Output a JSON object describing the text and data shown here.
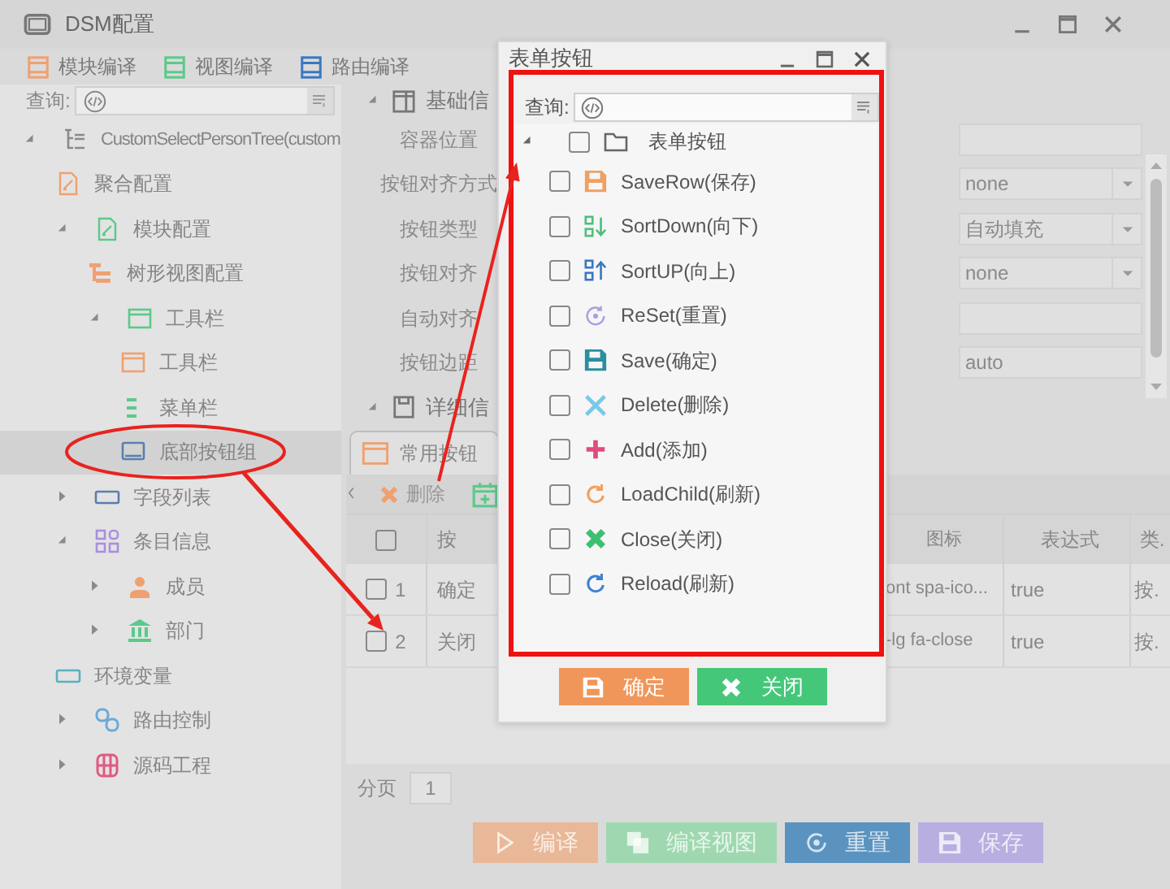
{
  "window": {
    "title": "DSM配置"
  },
  "toolbar": [
    {
      "label": "模块编译",
      "color": "#f0a070"
    },
    {
      "label": "视图编译",
      "color": "#5cc98a"
    },
    {
      "label": "路由编译",
      "color": "#3a78c0"
    }
  ],
  "sidebar": {
    "search_label": "查询:",
    "tree": [
      {
        "label": "CustomSelectPersonTree(custom",
        "kind": "tree",
        "color": "#8a8a8a",
        "expanded": true,
        "selected": false,
        "children": [
          {
            "label": "聚合配置",
            "kind": "doc",
            "color": "#f0a070",
            "selected": false
          },
          {
            "label": "模块配置",
            "kind": "doc",
            "color": "#5cc98a",
            "expanded": true,
            "selected": false,
            "children": [
              {
                "label": "树形视图配置",
                "kind": "hierarchy",
                "color": "#f0a070",
                "selected": false
              },
              {
                "label": "工具栏",
                "kind": "window",
                "color": "#5cc98a",
                "expanded": true,
                "selected": false,
                "children": [
                  {
                    "label": "工具栏",
                    "kind": "window",
                    "color": "#f0a070",
                    "selected": false
                  },
                  {
                    "label": "菜单栏",
                    "kind": "menu",
                    "color": "#5cc98a",
                    "selected": false
                  },
                  {
                    "label": "底部按钮组",
                    "kind": "panel",
                    "color": "#5b7fb0",
                    "selected": true
                  }
                ]
              }
            ]
          },
          {
            "label": "字段列表",
            "kind": "field",
            "color": "#5b7fb0",
            "expanded": false,
            "selected": false
          },
          {
            "label": "条目信息",
            "kind": "grid",
            "color": "#a98ee0",
            "expanded": true,
            "selected": false,
            "children": [
              {
                "label": "成员",
                "kind": "person",
                "color": "#f0a070",
                "expanded": false,
                "selected": false
              },
              {
                "label": "部门",
                "kind": "bank",
                "color": "#5cc98a",
                "expanded": false,
                "selected": false
              }
            ]
          },
          {
            "label": "环境变量",
            "kind": "field",
            "color": "#5ab0c0",
            "selected": false
          },
          {
            "label": "路由控制",
            "kind": "link",
            "color": "#6aaad8",
            "expanded": false,
            "selected": false
          },
          {
            "label": "源码工程",
            "kind": "code",
            "color": "#e05a80",
            "expanded": false,
            "selected": false
          }
        ]
      }
    ]
  },
  "basic_section": {
    "title": "基础信",
    "expanded": true,
    "properties": [
      {
        "label": "容器位置",
        "kind": "text"
      },
      {
        "label": "按钮对齐方式",
        "kind": "select",
        "value": "none"
      },
      {
        "label": "按钮类型",
        "kind": "select",
        "value": "自动填充"
      },
      {
        "label": "按钮对齐",
        "kind": "select",
        "value": "none"
      },
      {
        "label": "自动对齐",
        "kind": "text"
      },
      {
        "label": "按钮边距",
        "kind": "text",
        "value": "auto"
      }
    ]
  },
  "detail_section": {
    "title": "详细信",
    "expanded": true
  },
  "tabs": [
    {
      "label": "常用按钮",
      "selected": true
    }
  ],
  "grid_toolbar": [
    {
      "label": "删除",
      "kind": "delete"
    },
    {
      "kind": "add"
    }
  ],
  "table": {
    "header_checked": false,
    "columns": [
      "按",
      "图标",
      "表达式",
      "类."
    ],
    "rows": [
      {
        "number": "1",
        "checked": false,
        "cells": [
          "确定",
          "ont spa-ico...",
          "true",
          "按."
        ]
      },
      {
        "number": "2",
        "checked": false,
        "cells": [
          "关闭",
          "-lg fa-close",
          "true",
          "按."
        ]
      }
    ]
  },
  "pager": {
    "label": "分页",
    "value": "1"
  },
  "actions": [
    {
      "label": "编译",
      "kind": "play",
      "color": "#e8b898"
    },
    {
      "label": "编译视图",
      "kind": "copy",
      "color": "#9fd8b0"
    },
    {
      "label": "重置",
      "kind": "target",
      "color": "#5b93c0"
    },
    {
      "label": "保存",
      "kind": "save",
      "color": "#b8aee0"
    }
  ],
  "dialog": {
    "title": "表单按钮",
    "search_label": "查询:",
    "tree": {
      "label": "表单按钮",
      "expanded": true,
      "checked": false,
      "children": [
        {
          "label": "SaveRow(保存)",
          "kind": "save",
          "color": "#f0a060",
          "checked": false
        },
        {
          "label": "SortDown(向下)",
          "kind": "sort-down",
          "color": "#4cc07a",
          "checked": false
        },
        {
          "label": "SortUP(向上)",
          "kind": "sort-up",
          "color": "#3a78c0",
          "checked": false
        },
        {
          "label": "ReSet(重置)",
          "kind": "reset",
          "color": "#a99ee0",
          "checked": false
        },
        {
          "label": "Save(确定)",
          "kind": "save",
          "color": "#2a8fa0",
          "checked": false
        },
        {
          "label": "Delete(删除)",
          "kind": "cross",
          "color": "#7ac8e8",
          "checked": false
        },
        {
          "label": "Add(添加)",
          "kind": "plus",
          "color": "#e04a80",
          "checked": false
        },
        {
          "label": "LoadChild(刷新)",
          "kind": "refresh",
          "color": "#f0a060",
          "checked": false
        },
        {
          "label": "Close(关闭)",
          "kind": "cross-bold",
          "color": "#3cc070",
          "checked": false
        },
        {
          "label": "Reload(刷新)",
          "kind": "refresh",
          "color": "#4080d0",
          "checked": false
        }
      ]
    },
    "buttons": [
      {
        "label": "确定",
        "kind": "save",
        "color": "#f0965a"
      },
      {
        "label": "关闭",
        "kind": "cross-bold",
        "color": "#45c77a"
      }
    ]
  }
}
